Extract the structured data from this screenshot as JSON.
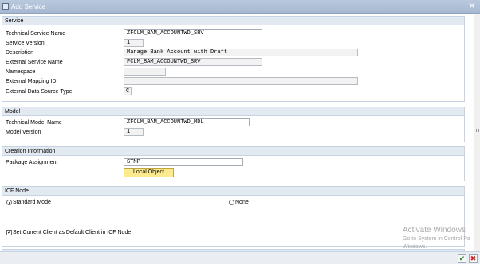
{
  "window": {
    "title": "Add Service",
    "close_glyph": "✕"
  },
  "service": {
    "header": "Service",
    "fields": [
      {
        "label": "Technical Service Name",
        "value": "ZFCLM_BAM_ACCOUNTWD_SRV"
      },
      {
        "label": "Service Version",
        "value": "1"
      },
      {
        "label": "Description",
        "value": "Manage Bank Account with Draft"
      },
      {
        "label": "External Service Name",
        "value": "FCLM_BAM_ACCOUNTWD_SRV"
      },
      {
        "label": "Namespace",
        "value": ""
      },
      {
        "label": "External Mapping ID",
        "value": ""
      },
      {
        "label": "External Data Source Type",
        "value": "C"
      }
    ]
  },
  "model": {
    "header": "Model",
    "fields": [
      {
        "label": "Technical Model Name",
        "value": "ZFCLM_BAM_ACCOUNTWD_MDL"
      },
      {
        "label": "Model Version",
        "value": "1"
      }
    ]
  },
  "creation": {
    "header": "Creation Information",
    "package_label": "Package Assignment",
    "package_value": "STMP",
    "local_object_button": "Local Object"
  },
  "icf": {
    "header": "ICF Node",
    "radio_standard": "Standard Mode",
    "radio_none": "None",
    "selected": "Standard Mode",
    "checkbox_label": "Set Current Client as Default Client in ICF Node",
    "checkbox_checked": true
  },
  "watermark": {
    "line1": "Activate Windows",
    "line2": "Go to System in Control Pa",
    "line3": "Windows."
  },
  "footer": {
    "ok_glyph": "✔",
    "cancel_glyph": "✖"
  },
  "colors": {
    "ok": "#2e8a2e",
    "cancel": "#d62020",
    "local_object_button": "#fde98e",
    "title_bar": "#b9c9dd"
  }
}
